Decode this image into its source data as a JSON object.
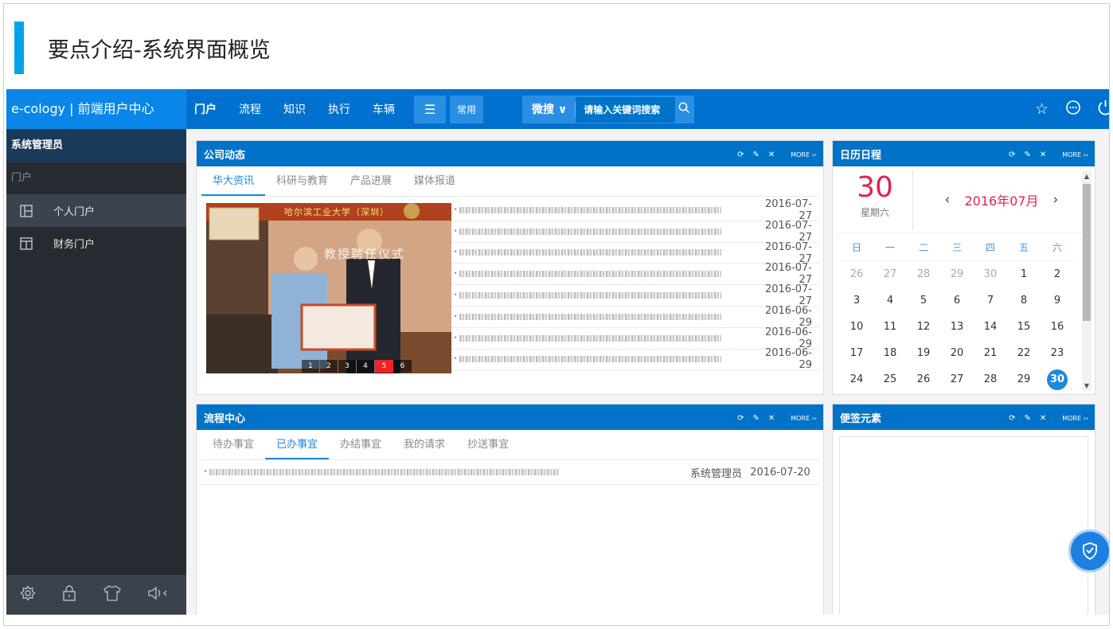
{
  "slide": {
    "title": "要点介绍-系统界面概览"
  },
  "app": {
    "brand": "e-cology | 前端用户中心",
    "nav": [
      {
        "label": "门户"
      },
      {
        "label": "流程"
      },
      {
        "label": "知识"
      },
      {
        "label": "执行"
      },
      {
        "label": "车辆"
      }
    ],
    "menu_icon": "☰",
    "common_label": "常用",
    "search": {
      "scope": "微搜 ∨",
      "placeholder": "请输入关键词搜索",
      "icon": "search-icon"
    },
    "top_icons": [
      "star-icon",
      "more-icon",
      "power-icon"
    ]
  },
  "sidebar": {
    "user": "系统管理员",
    "section": "门户",
    "items": [
      {
        "label": "个人门户",
        "icon": "portal-icon"
      },
      {
        "label": "财务门户",
        "icon": "finance-portal-icon"
      }
    ],
    "bottom_icons": [
      "settings-icon",
      "lock-icon",
      "theme-icon",
      "sound-icon"
    ]
  },
  "panel_tools": {
    "more": "MORE"
  },
  "news_panel": {
    "title": "公司动态",
    "tabs": [
      "华大资讯",
      "科研与教育",
      "产品进展",
      "媒体报道"
    ],
    "slider": {
      "banner": "哈尔滨工业大学（深圳）",
      "backdrop": "教授聘任仪式",
      "pages": [
        "1",
        "2",
        "3",
        "4",
        "5",
        "6"
      ],
      "active": "5"
    },
    "dates": [
      "2016-07-27",
      "2016-07-27",
      "2016-07-27",
      "2016-07-27",
      "2016-07-27",
      "2016-06-29",
      "2016-06-29",
      "2016-06-29"
    ]
  },
  "calendar": {
    "title": "日历日程",
    "day": "30",
    "weekday": "星期六",
    "month": "2016年07月",
    "prev": "‹",
    "next": "›",
    "weekdays": [
      "日",
      "一",
      "二",
      "三",
      "四",
      "五",
      "六"
    ],
    "weeks": [
      [
        "26",
        "27",
        "28",
        "29",
        "30",
        "1",
        "2"
      ],
      [
        "3",
        "4",
        "5",
        "6",
        "7",
        "8",
        "9"
      ],
      [
        "10",
        "11",
        "12",
        "13",
        "14",
        "15",
        "16"
      ],
      [
        "17",
        "18",
        "19",
        "20",
        "21",
        "22",
        "23"
      ],
      [
        "24",
        "25",
        "26",
        "27",
        "28",
        "29",
        "30"
      ]
    ]
  },
  "workflow_panel": {
    "title": "流程中心",
    "tabs": [
      "待办事宜",
      "已办事宜",
      "办结事宜",
      "我的请求",
      "抄送事宜"
    ],
    "active_tab": 1,
    "rows": [
      {
        "creator": "系统管理员",
        "date": "2016-07-20"
      }
    ]
  },
  "note_panel": {
    "title": "便签元素"
  }
}
